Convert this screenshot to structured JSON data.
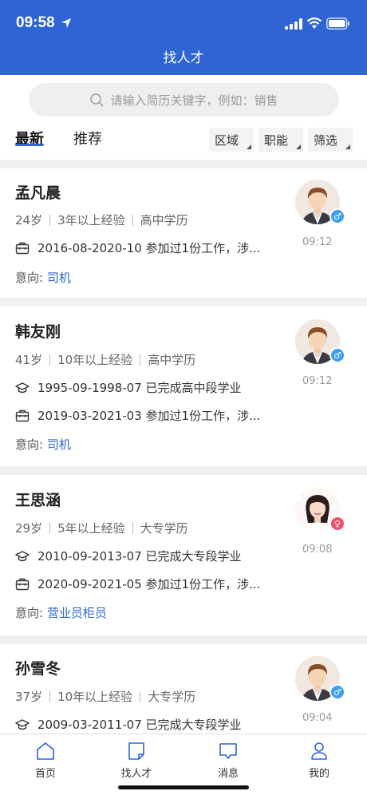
{
  "status": {
    "time": "09:58"
  },
  "nav": {
    "title": "找人才"
  },
  "search": {
    "placeholder": "请输入简历关键字，例如：销售"
  },
  "tabs": [
    {
      "label": "最新"
    },
    {
      "label": "推荐"
    }
  ],
  "filters": [
    {
      "label": "区域"
    },
    {
      "label": "职能"
    },
    {
      "label": "筛选"
    }
  ],
  "candidates": [
    {
      "name": "孟凡晨",
      "age": "24岁",
      "experience": "3年以上经验",
      "education": "高中学历",
      "gender": "male",
      "time": "09:12",
      "records": [
        {
          "icon": "briefcase-icon",
          "text": "2016-08-2020-10 参加过1份工作，涉..."
        }
      ],
      "intent_label": "意向:",
      "intent_job": "司机"
    },
    {
      "name": "韩友刚",
      "age": "41岁",
      "experience": "10年以上经验",
      "education": "高中学历",
      "gender": "male",
      "time": "09:12",
      "records": [
        {
          "icon": "graduation-cap-icon",
          "text": "1995-09-1998-07 已完成高中段学业"
        },
        {
          "icon": "briefcase-icon",
          "text": "2019-03-2021-03 参加过1份工作，涉..."
        }
      ],
      "intent_label": "意向:",
      "intent_job": "司机"
    },
    {
      "name": "王思涵",
      "age": "29岁",
      "experience": "5年以上经验",
      "education": "大专学历",
      "gender": "female",
      "time": "09:08",
      "records": [
        {
          "icon": "graduation-cap-icon",
          "text": "2010-09-2013-07 已完成大专段学业"
        },
        {
          "icon": "briefcase-icon",
          "text": "2020-09-2021-05 参加过1份工作，涉..."
        }
      ],
      "intent_label": "意向:",
      "intent_job": "营业员柜员"
    },
    {
      "name": "孙雪冬",
      "age": "37岁",
      "experience": "10年以上经验",
      "education": "大专学历",
      "gender": "male",
      "time": "09:04",
      "records": [
        {
          "icon": "graduation-cap-icon",
          "text": "2009-03-2011-07 已完成大专段学业"
        }
      ]
    }
  ],
  "tabbar": [
    {
      "label": "首页",
      "icon": "home-icon"
    },
    {
      "label": "找人才",
      "icon": "document-icon"
    },
    {
      "label": "消息",
      "icon": "message-icon"
    },
    {
      "label": "我的",
      "icon": "user-icon"
    }
  ],
  "colors": {
    "primary": "#2f64d4",
    "male": "#3b9ef0",
    "female": "#f0506e"
  }
}
